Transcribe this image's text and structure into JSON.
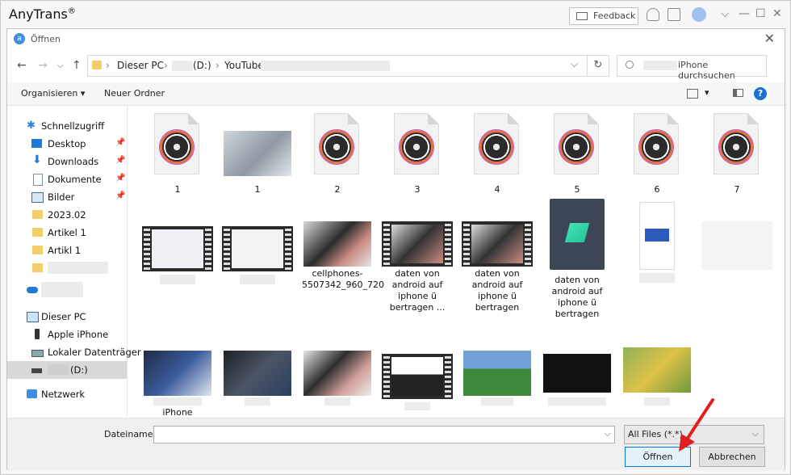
{
  "app": {
    "title": "AnyTrans",
    "reg": "®",
    "feedback": "Feedback"
  },
  "dialog": {
    "title": "Öffnen",
    "breadcrumb": [
      "Dieser PC",
      "(D:)",
      "YouTube"
    ],
    "search_placeholder": "iPhone durchsuchen",
    "toolbar": {
      "organize": "Organisieren",
      "new_folder": "Neuer Ordner"
    },
    "sidebar": [
      {
        "label": "Schnellzugriff",
        "icon": "star-icon"
      },
      {
        "label": "Desktop",
        "icon": "desktop-icon",
        "pinned": true
      },
      {
        "label": "Downloads",
        "icon": "download-icon",
        "pinned": true
      },
      {
        "label": "Dokumente",
        "icon": "document-icon",
        "pinned": true
      },
      {
        "label": "Bilder",
        "icon": "pictures-icon",
        "pinned": true
      },
      {
        "label": "2023.02",
        "icon": "folder-icon"
      },
      {
        "label": "Artikel 1",
        "icon": "folder-icon"
      },
      {
        "label": "Artikl 1",
        "icon": "folder-icon"
      },
      {
        "label": "",
        "icon": "folder-icon"
      },
      {
        "label": "",
        "icon": "cloud-icon"
      },
      {
        "label": "Dieser PC",
        "icon": "computer-icon"
      },
      {
        "label": "Apple iPhone",
        "icon": "phone-icon"
      },
      {
        "label": "Lokaler Datenträger",
        "icon": "drive-icon"
      },
      {
        "label": "(D:)",
        "icon": "drive-icon",
        "selected": true
      },
      {
        "label": "Netzwerk",
        "icon": "network-icon"
      }
    ],
    "files": [
      {
        "name": "1",
        "kind": "disc"
      },
      {
        "name": "1",
        "kind": "photo"
      },
      {
        "name": "2",
        "kind": "disc"
      },
      {
        "name": "3",
        "kind": "disc"
      },
      {
        "name": "4",
        "kind": "disc"
      },
      {
        "name": "5",
        "kind": "disc"
      },
      {
        "name": "6",
        "kind": "disc"
      },
      {
        "name": "7",
        "kind": "disc"
      },
      {
        "name": "",
        "kind": "film"
      },
      {
        "name": "",
        "kind": "film"
      },
      {
        "name": "cellphones-5507342_960_720",
        "kind": "photo"
      },
      {
        "name": "daten von android auf iphone ü bertragen ...",
        "kind": "film"
      },
      {
        "name": "daten von android auf iphone ü bertragen",
        "kind": "film"
      },
      {
        "name": "daten von android auf iphone ü bertragen",
        "kind": "filmora"
      },
      {
        "name": "",
        "kind": "screenshot"
      },
      {
        "name": "",
        "kind": "blank"
      },
      {
        "name": "iPhone",
        "kind": "photo"
      },
      {
        "name": "",
        "kind": "photo"
      },
      {
        "name": "",
        "kind": "photo"
      },
      {
        "name": "",
        "kind": "film"
      },
      {
        "name": "",
        "kind": "photo"
      },
      {
        "name": "",
        "kind": "photo"
      },
      {
        "name": "",
        "kind": "photo"
      }
    ],
    "filename_label": "Dateiname:",
    "filename_value": "",
    "filetype": "All Files (*.*)",
    "open": "Öffnen",
    "cancel": "Abbrechen"
  }
}
